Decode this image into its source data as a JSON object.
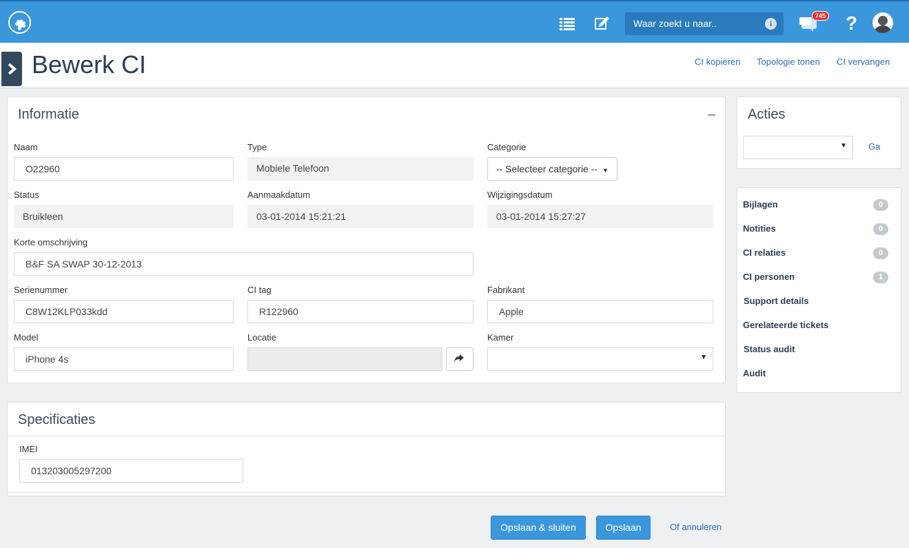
{
  "topbar": {
    "search_placeholder": "Waar zoekt u naar..",
    "notifications_count": "745",
    "icons": [
      "puzzle-logo-icon",
      "list-icon",
      "edit-icon",
      "info-icon",
      "chat-icon",
      "help-icon",
      "user-avatar"
    ]
  },
  "header": {
    "title": "Bewerk CI",
    "links": [
      "CI kopiëren",
      "Topologie tonen",
      "CI vervangen"
    ]
  },
  "informatie": {
    "title": "Informatie",
    "collapse": "–",
    "naam_label": "Naam",
    "naam_value": "O22960",
    "type_label": "Type",
    "type_value": "Mobiele Telefoon",
    "categorie_label": "Categorie",
    "categorie_value": "-- Selecteer categorie --",
    "status_label": "Status",
    "status_value": "Bruikleen",
    "aanmaak_label": "Aanmaakdatum",
    "aanmaak_value": "03-01-2014 15:21:21",
    "wijziging_label": "Wijzigingsdatum",
    "wijziging_value": "03-01-2014 15:27:27",
    "omschrijving_label": "Korte omschrijving",
    "omschrijving_value": "B&F SA SWAP 30-12-2013",
    "serie_label": "Serienummer",
    "serie_value": "C8W12KLP033kdd",
    "citag_label": "CI tag",
    "citag_value": "R122960",
    "fabrikant_label": "Fabrikant",
    "fabrikant_value": "Apple",
    "model_label": "Model",
    "model_value": "iPhone 4s",
    "locatie_label": "Locatie",
    "locatie_value": "",
    "kamer_label": "Kamer",
    "kamer_value": ""
  },
  "specificaties": {
    "title": "Specificaties",
    "imei_label": "IMEI",
    "imei_value": "013203005297200"
  },
  "acties": {
    "title": "Acties",
    "select_value": "",
    "go_label": "Ga"
  },
  "sidebar": {
    "items": [
      {
        "label": "Bijlagen",
        "count": "0"
      },
      {
        "label": "Notities",
        "count": "0"
      },
      {
        "label": "CI relaties",
        "count": "0"
      },
      {
        "label": "CI personen",
        "count": "1"
      },
      {
        "label": "Support details"
      },
      {
        "label": "Gerelateerde tickets"
      },
      {
        "label": "Status audit"
      },
      {
        "label": "Audit"
      }
    ]
  },
  "footer": {
    "save_close": "Opslaan & sluiten",
    "save": "Opslaan",
    "cancel": "Of annuleren"
  }
}
